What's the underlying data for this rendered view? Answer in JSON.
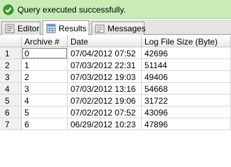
{
  "status": {
    "message": "Query executed successfully.",
    "icon": "success-check-icon",
    "color": "#c9ecb7"
  },
  "tabs": [
    {
      "label": "Editor",
      "icon": "editor-icon"
    },
    {
      "label": "Results",
      "icon": "results-grid-icon"
    },
    {
      "label": "Messages",
      "icon": "messages-icon"
    }
  ],
  "active_tab": "Results",
  "grid": {
    "columns": [
      "Archive #",
      "Date",
      "Log File Size (Byte)"
    ],
    "rows": [
      {
        "num": "1",
        "cells": [
          "0",
          "07/04/2012  07:52",
          "42696"
        ]
      },
      {
        "num": "2",
        "cells": [
          "1",
          "07/03/2012  22:31",
          "51144"
        ]
      },
      {
        "num": "3",
        "cells": [
          "2",
          "07/03/2012  19:03",
          "49406"
        ]
      },
      {
        "num": "4",
        "cells": [
          "3",
          "07/03/2012  13:16",
          "54668"
        ]
      },
      {
        "num": "5",
        "cells": [
          "4",
          "07/02/2012  19:06",
          "31722"
        ]
      },
      {
        "num": "6",
        "cells": [
          "5",
          "07/02/2012  07:52",
          "43096"
        ]
      },
      {
        "num": "7",
        "cells": [
          "6",
          "06/29/2012  10:23",
          "47896"
        ]
      }
    ]
  }
}
